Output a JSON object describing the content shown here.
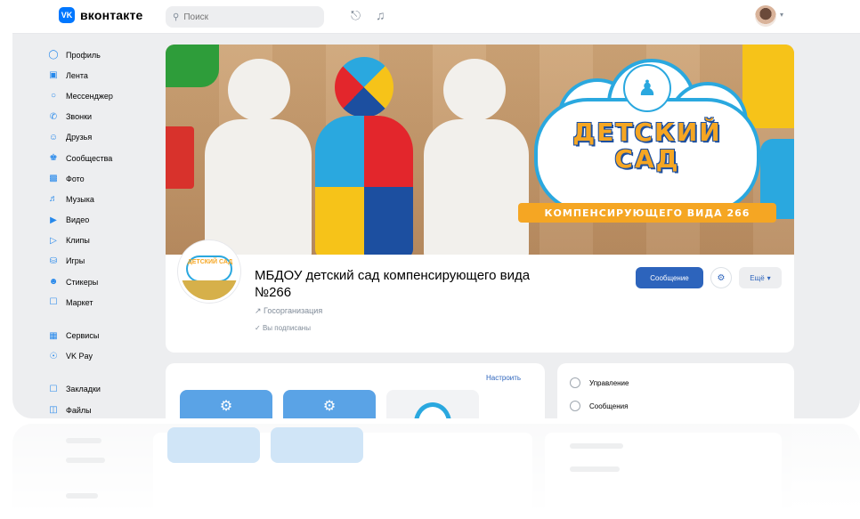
{
  "header": {
    "logo_mark": "VK",
    "logo_text": "вконтакте",
    "search_placeholder": "Поиск"
  },
  "sidebar": {
    "items": [
      {
        "label": "Профиль",
        "icon": "profile-icon"
      },
      {
        "label": "Лента",
        "icon": "feed-icon"
      },
      {
        "label": "Мессенджер",
        "icon": "messenger-icon"
      },
      {
        "label": "Звонки",
        "icon": "calls-icon"
      },
      {
        "label": "Друзья",
        "icon": "friends-icon"
      },
      {
        "label": "Сообщества",
        "icon": "communities-icon"
      },
      {
        "label": "Фото",
        "icon": "photo-icon"
      },
      {
        "label": "Музыка",
        "icon": "music-icon"
      },
      {
        "label": "Видео",
        "icon": "video-icon"
      },
      {
        "label": "Клипы",
        "icon": "clips-icon"
      },
      {
        "label": "Игры",
        "icon": "games-icon"
      },
      {
        "label": "Стикеры",
        "icon": "stickers-icon"
      },
      {
        "label": "Маркет",
        "icon": "market-icon"
      }
    ],
    "secondary": [
      {
        "label": "Сервисы",
        "icon": "services-icon"
      },
      {
        "label": "VK Pay",
        "icon": "vkpay-icon"
      }
    ],
    "tertiary": [
      {
        "label": "Закладки",
        "icon": "bookmarks-icon"
      },
      {
        "label": "Файлы",
        "icon": "files-icon"
      }
    ]
  },
  "cover": {
    "title": "ДЕТСКИЙ САД",
    "ribbon": "КОМПЕНСИРУЮЩЕГО ВИДА 266"
  },
  "profile": {
    "avatar_text": "ДЕТСКИЙ САД",
    "name": "МБДОУ детский сад компенсирующего вида №266",
    "type": "Госорганизация",
    "subscribed": "Вы подписаны",
    "message_button": "Сообщение",
    "more_button": "Ещё"
  },
  "widgets": {
    "settings_link": "Настроить"
  },
  "actions": {
    "items": [
      "Управление",
      "Сообщения"
    ]
  },
  "colors": {
    "accent": "#2d64bc",
    "brand": "#0077ff",
    "page_bg": "#edeef0"
  }
}
